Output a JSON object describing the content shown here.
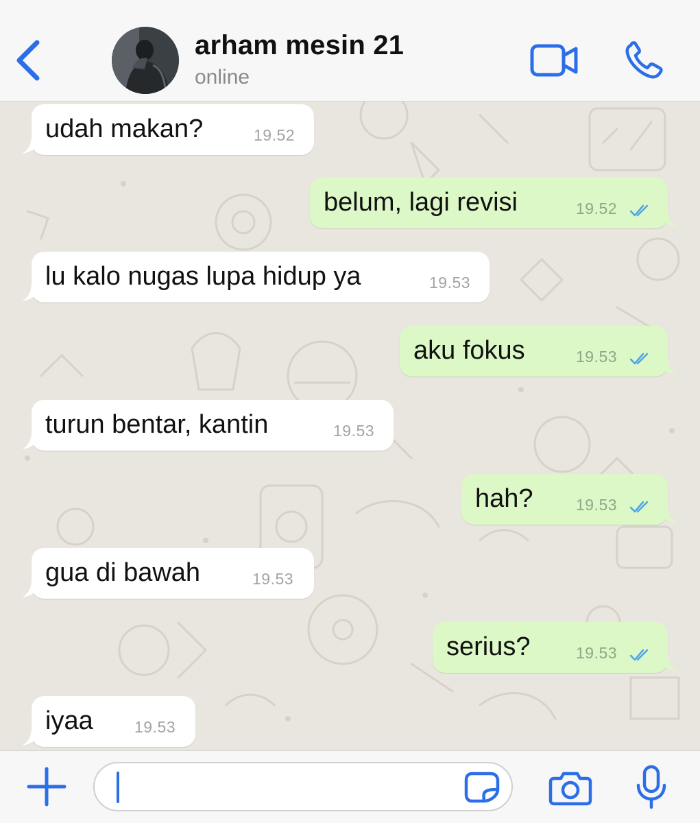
{
  "header": {
    "contact_name": "arham mesin 21",
    "status": "online"
  },
  "colors": {
    "accent": "#2c6ee8",
    "incoming_bubble": "#ffffff",
    "outgoing_bubble": "#dcf8c6",
    "chat_background": "#e9e6df",
    "read_ticks": "#4fa3e8"
  },
  "icons": {
    "back": "chevron-left-icon",
    "video": "video-camera-icon",
    "call": "phone-icon",
    "attach": "plus-icon",
    "sticker": "sticker-icon",
    "camera": "camera-icon",
    "mic": "microphone-icon",
    "read": "double-check-icon"
  },
  "messages": [
    {
      "direction": "in",
      "text": "udah makan?",
      "time": "19.52"
    },
    {
      "direction": "out",
      "text": "belum, lagi revisi",
      "time": "19.52",
      "read": true
    },
    {
      "direction": "in",
      "text": "lu kalo nugas lupa hidup ya",
      "time": "19.53"
    },
    {
      "direction": "out",
      "text": "aku fokus",
      "time": "19.53",
      "read": true
    },
    {
      "direction": "in",
      "text": "turun bentar, kantin",
      "time": "19.53"
    },
    {
      "direction": "out",
      "text": "hah?",
      "time": "19.53",
      "read": true
    },
    {
      "direction": "in",
      "text": "gua di bawah",
      "time": "19.53"
    },
    {
      "direction": "out",
      "text": "serius?",
      "time": "19.53",
      "read": true
    },
    {
      "direction": "in",
      "text": "iyaa",
      "time": "19.53"
    }
  ],
  "composer": {
    "value": ""
  }
}
